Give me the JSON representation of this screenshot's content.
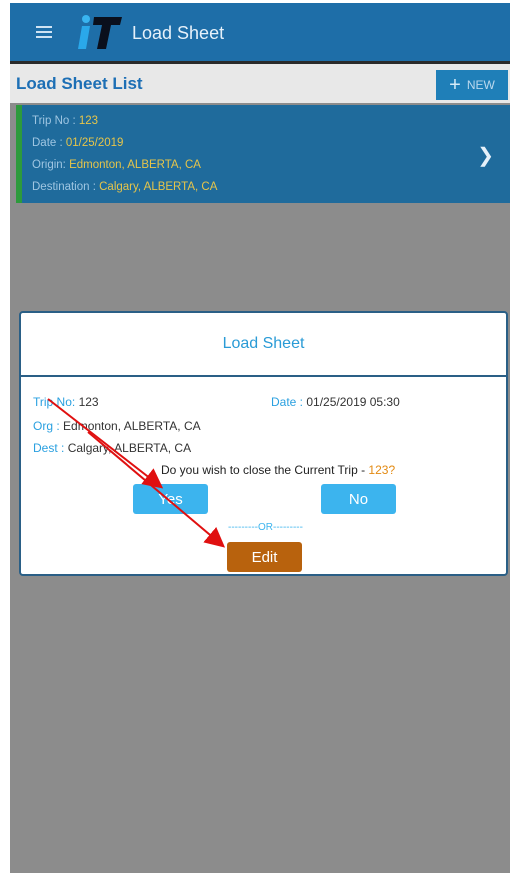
{
  "appbar": {
    "title": "Load Sheet"
  },
  "subbar": {
    "title": "Load Sheet List",
    "new_label": "NEW"
  },
  "trip_card": {
    "trip_label": "Trip No : ",
    "trip_value": "123",
    "date_label": "Date : ",
    "date_value": "01/25/2019",
    "origin_label": "Origin: ",
    "origin_value": "Edmonton, ALBERTA, CA",
    "dest_label": "Destination : ",
    "dest_value": "Calgary, ALBERTA, CA"
  },
  "dialog": {
    "title": "Load Sheet",
    "trip_label": "Trip No:",
    "trip_value": "123",
    "date_label": "Date :",
    "date_value": "01/25/2019 05:30",
    "org_label": "Org :",
    "org_value": "Edmonton, ALBERTA, CA",
    "dest_label": "Dest :",
    "dest_value": "Calgary, ALBERTA, CA",
    "question": "Do you wish to close the Current Trip - ",
    "question_highlight": "123?",
    "yes_label": "Yes",
    "no_label": "No",
    "or_label": "---------OR---------",
    "edit_label": "Edit"
  },
  "colors": {
    "appbar": "#1e6ea8",
    "accent": "#3cb4ee",
    "edit": "#b8620d",
    "annotation": "#e01010"
  }
}
